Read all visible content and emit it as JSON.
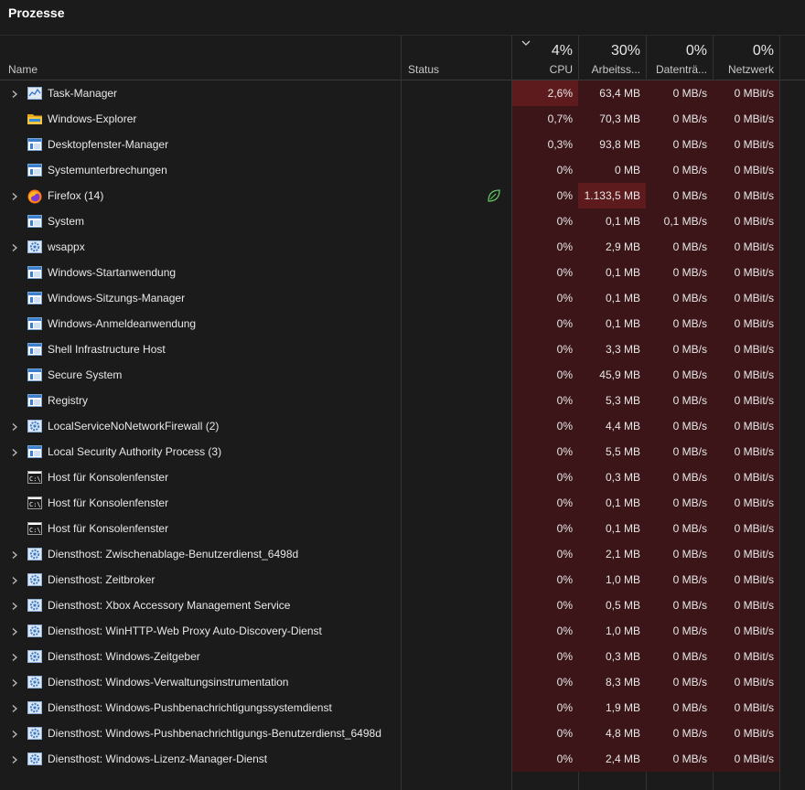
{
  "title": "Prozesse",
  "columns": {
    "name": "Name",
    "status": "Status",
    "cpu": {
      "pct": "4%",
      "label": "CPU"
    },
    "memory": {
      "pct": "30%",
      "label": "Arbeitss..."
    },
    "disk": {
      "pct": "0%",
      "label": "Datenträ..."
    },
    "network": {
      "pct": "0%",
      "label": "Netzwerk"
    }
  },
  "processes": [
    {
      "name": "Task-Manager",
      "icon": "taskmanager-icon",
      "expandable": true,
      "cpu": "2,6%",
      "mem": "63,4 MB",
      "disk": "0 MB/s",
      "net": "0 MBit/s"
    },
    {
      "name": "Windows-Explorer",
      "icon": "folder-icon",
      "expandable": false,
      "cpu": "0,7%",
      "mem": "70,3 MB",
      "disk": "0 MB/s",
      "net": "0 MBit/s"
    },
    {
      "name": "Desktopfenster-Manager",
      "icon": "window-icon",
      "expandable": false,
      "cpu": "0,3%",
      "mem": "93,8 MB",
      "disk": "0 MB/s",
      "net": "0 MBit/s"
    },
    {
      "name": "Systemunterbrechungen",
      "icon": "window-icon",
      "expandable": false,
      "cpu": "0%",
      "mem": "0 MB",
      "disk": "0 MB/s",
      "net": "0 MBit/s"
    },
    {
      "name": "Firefox (14)",
      "icon": "firefox-icon",
      "expandable": true,
      "status_icon": "eco-leaf-icon",
      "cpu": "0%",
      "mem": "1.133,5 MB",
      "disk": "0 MB/s",
      "net": "0 MBit/s"
    },
    {
      "name": "System",
      "icon": "window-icon",
      "expandable": false,
      "cpu": "0%",
      "mem": "0,1 MB",
      "disk": "0,1 MB/s",
      "net": "0 MBit/s"
    },
    {
      "name": "wsappx",
      "icon": "gear-icon",
      "expandable": true,
      "cpu": "0%",
      "mem": "2,9 MB",
      "disk": "0 MB/s",
      "net": "0 MBit/s"
    },
    {
      "name": "Windows-Startanwendung",
      "icon": "window-icon",
      "expandable": false,
      "cpu": "0%",
      "mem": "0,1 MB",
      "disk": "0 MB/s",
      "net": "0 MBit/s"
    },
    {
      "name": "Windows-Sitzungs-Manager",
      "icon": "window-icon",
      "expandable": false,
      "cpu": "0%",
      "mem": "0,1 MB",
      "disk": "0 MB/s",
      "net": "0 MBit/s"
    },
    {
      "name": "Windows-Anmeldeanwendung",
      "icon": "window-icon",
      "expandable": false,
      "cpu": "0%",
      "mem": "0,1 MB",
      "disk": "0 MB/s",
      "net": "0 MBit/s"
    },
    {
      "name": "Shell Infrastructure Host",
      "icon": "window-icon",
      "expandable": false,
      "cpu": "0%",
      "mem": "3,3 MB",
      "disk": "0 MB/s",
      "net": "0 MBit/s"
    },
    {
      "name": "Secure System",
      "icon": "window-icon",
      "expandable": false,
      "cpu": "0%",
      "mem": "45,9 MB",
      "disk": "0 MB/s",
      "net": "0 MBit/s"
    },
    {
      "name": "Registry",
      "icon": "window-icon",
      "expandable": false,
      "cpu": "0%",
      "mem": "5,3 MB",
      "disk": "0 MB/s",
      "net": "0 MBit/s"
    },
    {
      "name": "LocalServiceNoNetworkFirewall (2)",
      "icon": "gear-icon",
      "expandable": true,
      "cpu": "0%",
      "mem": "4,4 MB",
      "disk": "0 MB/s",
      "net": "0 MBit/s"
    },
    {
      "name": "Local Security Authority Process (3)",
      "icon": "window-icon",
      "expandable": true,
      "cpu": "0%",
      "mem": "5,5 MB",
      "disk": "0 MB/s",
      "net": "0 MBit/s"
    },
    {
      "name": "Host für Konsolenfenster",
      "icon": "console-icon",
      "expandable": false,
      "cpu": "0%",
      "mem": "0,3 MB",
      "disk": "0 MB/s",
      "net": "0 MBit/s"
    },
    {
      "name": "Host für Konsolenfenster",
      "icon": "console-icon",
      "expandable": false,
      "cpu": "0%",
      "mem": "0,1 MB",
      "disk": "0 MB/s",
      "net": "0 MBit/s"
    },
    {
      "name": "Host für Konsolenfenster",
      "icon": "console-icon",
      "expandable": false,
      "cpu": "0%",
      "mem": "0,1 MB",
      "disk": "0 MB/s",
      "net": "0 MBit/s"
    },
    {
      "name": "Diensthost: Zwischenablage-Benutzerdienst_6498d",
      "icon": "gear-icon",
      "expandable": true,
      "cpu": "0%",
      "mem": "2,1 MB",
      "disk": "0 MB/s",
      "net": "0 MBit/s"
    },
    {
      "name": "Diensthost: Zeitbroker",
      "icon": "gear-icon",
      "expandable": true,
      "cpu": "0%",
      "mem": "1,0 MB",
      "disk": "0 MB/s",
      "net": "0 MBit/s"
    },
    {
      "name": "Diensthost: Xbox Accessory Management Service",
      "icon": "gear-icon",
      "expandable": true,
      "cpu": "0%",
      "mem": "0,5 MB",
      "disk": "0 MB/s",
      "net": "0 MBit/s"
    },
    {
      "name": "Diensthost: WinHTTP-Web Proxy Auto-Discovery-Dienst",
      "icon": "gear-icon",
      "expandable": true,
      "cpu": "0%",
      "mem": "1,0 MB",
      "disk": "0 MB/s",
      "net": "0 MBit/s"
    },
    {
      "name": "Diensthost: Windows-Zeitgeber",
      "icon": "gear-icon",
      "expandable": true,
      "cpu": "0%",
      "mem": "0,3 MB",
      "disk": "0 MB/s",
      "net": "0 MBit/s"
    },
    {
      "name": "Diensthost: Windows-Verwaltungsinstrumentation",
      "icon": "gear-icon",
      "expandable": true,
      "cpu": "0%",
      "mem": "8,3 MB",
      "disk": "0 MB/s",
      "net": "0 MBit/s"
    },
    {
      "name": "Diensthost: Windows-Pushbenachrichtigungssystemdienst",
      "icon": "gear-icon",
      "expandable": true,
      "cpu": "0%",
      "mem": "1,9 MB",
      "disk": "0 MB/s",
      "net": "0 MBit/s"
    },
    {
      "name": "Diensthost: Windows-Pushbenachrichtigungs-Benutzerdienst_6498d",
      "icon": "gear-icon",
      "expandable": true,
      "cpu": "0%",
      "mem": "4,8 MB",
      "disk": "0 MB/s",
      "net": "0 MBit/s"
    },
    {
      "name": "Diensthost: Windows-Lizenz-Manager-Dienst",
      "icon": "gear-icon",
      "expandable": true,
      "cpu": "0%",
      "mem": "2,4 MB",
      "disk": "0 MB/s",
      "net": "0 MBit/s"
    }
  ],
  "colors": {
    "accent_hot": "#5e1b1e",
    "accent_warm": "#4d1a1c",
    "heat_bg": "#3b1518",
    "bg": "#1b1b1b"
  }
}
